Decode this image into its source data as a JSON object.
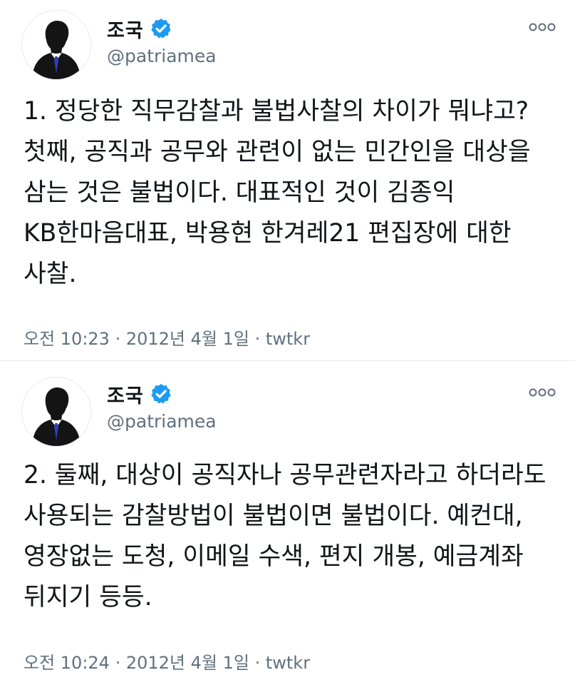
{
  "tweets": [
    {
      "user": {
        "display_name": "조국",
        "handle": "@patriamea",
        "verified": true
      },
      "text": "1. 정당한 직무감찰과 불법사찰의 차이가 뭐냐고? 첫째, 공직과 공무와 관련이 없는 민간인을 대상을 삼는 것은 불법이다. 대표적인 것이 김종익 KB한마음대표, 박용현 한겨레21 편집장에 대한 사찰.",
      "time": "오전 10:23",
      "date": "2012년 4월 1일",
      "source": "twtkr"
    },
    {
      "user": {
        "display_name": "조국",
        "handle": "@patriamea",
        "verified": true
      },
      "text": "2. 둘째, 대상이 공직자나 공무관련자라고 하더라도 사용되는 감찰방법이 불법이면 불법이다. 예컨대, 영장없는 도청, 이메일 수색, 편지 개봉, 예금계좌 뒤지기 등등.",
      "time": "오전 10:24",
      "date": "2012년 4월 1일",
      "source": "twtkr"
    }
  ],
  "separator": " · ",
  "icons": {
    "avatar": "person-silhouette-icon",
    "verified": "verified-badge-icon",
    "more": "more-options-icon"
  },
  "colors": {
    "text": "#111418",
    "secondary": "#60707f",
    "verified": "#1d9bf0",
    "divider": "#e6ecf0"
  }
}
